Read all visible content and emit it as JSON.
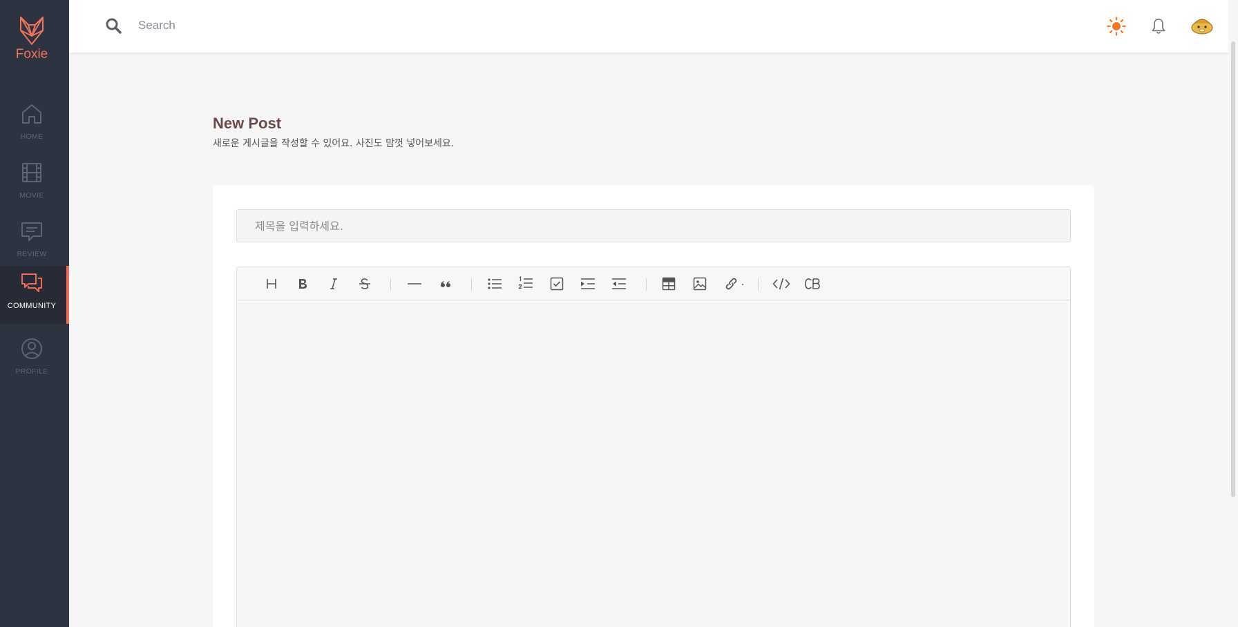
{
  "app": {
    "brand": "Foxie",
    "brand_color": "#f0735e"
  },
  "sidebar": {
    "items": [
      {
        "label": "HOME",
        "icon": "home-icon",
        "active": false
      },
      {
        "label": "MOVIE",
        "icon": "film-icon",
        "active": false
      },
      {
        "label": "REVIEW",
        "icon": "review-icon",
        "active": false
      },
      {
        "label": "COMMUNITY",
        "icon": "chat-icon",
        "active": true
      },
      {
        "label": "PROFILE",
        "icon": "user-icon",
        "active": false
      }
    ],
    "background": "#2d3340",
    "active_accent": "#ef6a5b"
  },
  "header": {
    "search": {
      "placeholder": "Search",
      "value": ""
    },
    "icons": [
      "search-icon",
      "sun-icon",
      "bell-icon",
      "avatar"
    ],
    "theme_icon_color": "#f07a2a"
  },
  "page": {
    "title": "New Post",
    "subtitle": "새로운 게시글을 작성할 수 있어요. 사진도 맘껏 넣어보세요."
  },
  "form": {
    "title_input": {
      "placeholder": "제목을 입력하세요.",
      "value": ""
    },
    "editor": {
      "toolbar": [
        {
          "name": "heading",
          "icon": "heading-icon",
          "glyph": "H"
        },
        {
          "name": "bold",
          "icon": "bold-icon",
          "glyph": "B"
        },
        {
          "name": "italic",
          "icon": "italic-icon",
          "glyph": "I"
        },
        {
          "name": "strike",
          "icon": "strikethrough-icon",
          "glyph": "S"
        },
        {
          "name": "hr",
          "icon": "horizontal-rule-icon"
        },
        {
          "name": "quote",
          "icon": "quote-icon",
          "glyph": "66"
        },
        {
          "name": "ul",
          "icon": "bullet-list-icon"
        },
        {
          "name": "ol",
          "icon": "numbered-list-icon"
        },
        {
          "name": "task",
          "icon": "task-list-icon"
        },
        {
          "name": "indent",
          "icon": "indent-icon"
        },
        {
          "name": "outdent",
          "icon": "outdent-icon"
        },
        {
          "name": "table",
          "icon": "table-icon"
        },
        {
          "name": "image",
          "icon": "image-icon"
        },
        {
          "name": "link",
          "icon": "link-icon"
        },
        {
          "name": "code",
          "icon": "code-icon"
        },
        {
          "name": "codeblock",
          "icon": "code-block-icon",
          "glyph": "CB"
        }
      ],
      "content": ""
    }
  }
}
